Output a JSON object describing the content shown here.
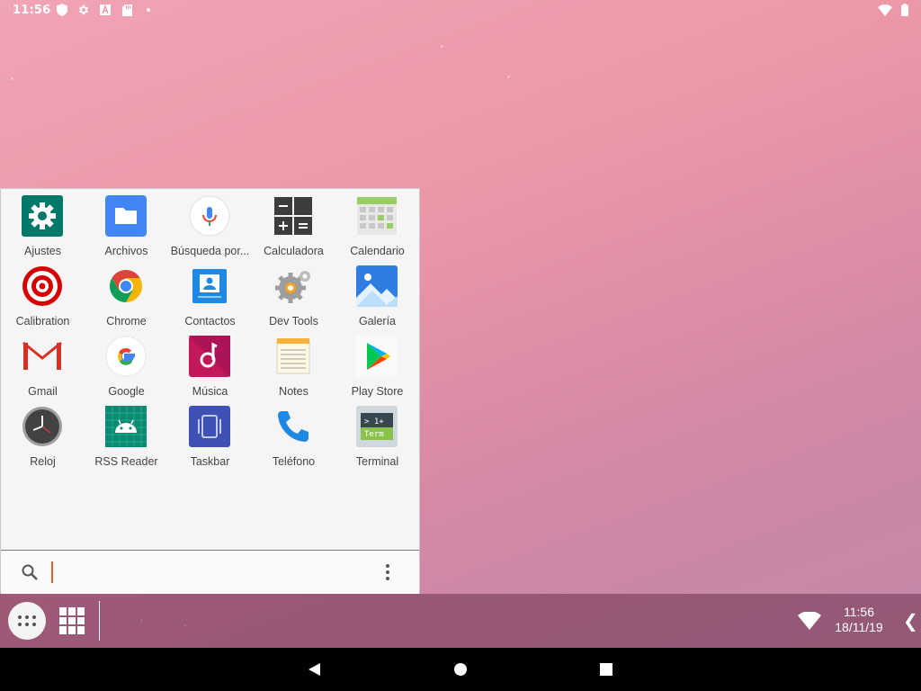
{
  "status_bar": {
    "time": "11:56"
  },
  "apps": [
    {
      "label": "Ajustes",
      "icon": "settings-icon"
    },
    {
      "label": "Archivos",
      "icon": "folder-icon"
    },
    {
      "label": "Búsqueda por...",
      "icon": "microphone-icon"
    },
    {
      "label": "Calculadora",
      "icon": "calculator-icon"
    },
    {
      "label": "Calendario",
      "icon": "calendar-icon"
    },
    {
      "label": "Calibration",
      "icon": "target-icon"
    },
    {
      "label": "Chrome",
      "icon": "chrome-icon"
    },
    {
      "label": "Contactos",
      "icon": "contacts-icon"
    },
    {
      "label": "Dev Tools",
      "icon": "gears-icon"
    },
    {
      "label": "Galería",
      "icon": "gallery-icon"
    },
    {
      "label": "Gmail",
      "icon": "gmail-icon"
    },
    {
      "label": "Google",
      "icon": "google-icon"
    },
    {
      "label": "Música",
      "icon": "music-icon"
    },
    {
      "label": "Notes",
      "icon": "notepad-icon"
    },
    {
      "label": "Play Store",
      "icon": "play-store-icon"
    },
    {
      "label": "Reloj",
      "icon": "clock-icon"
    },
    {
      "label": "RSS Reader",
      "icon": "android-icon"
    },
    {
      "label": "Taskbar",
      "icon": "taskbar-app-icon"
    },
    {
      "label": "Teléfono",
      "icon": "phone-icon"
    },
    {
      "label": "Terminal",
      "icon": "terminal-icon"
    }
  ],
  "search": {
    "value": "",
    "placeholder": ""
  },
  "taskbar": {
    "time": "11:56",
    "date": "18/11/19",
    "collapse_glyph": "❮"
  },
  "colors": {
    "cursor": "#e2601f",
    "drawer_bg": "#f5f5f5",
    "taskbar_bg": "rgba(110,50,80,0.55)"
  }
}
